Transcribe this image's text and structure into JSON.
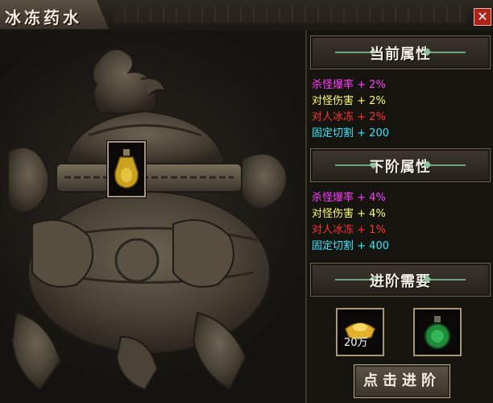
{
  "window": {
    "title": "冰冻药水",
    "close_label": "✕"
  },
  "colors": {
    "pink": "#ff3dff",
    "yellow": "#ffff66",
    "red": "#ff3131",
    "cyan": "#33e6ff"
  },
  "current_attrs": {
    "header": "当前属性",
    "rows": [
      {
        "name": "杀怪爆率",
        "value": "+ 2%",
        "color": "pink"
      },
      {
        "name": "对怪伤害",
        "value": "+ 2%",
        "color": "yellow"
      },
      {
        "name": "对人冰冻",
        "value": "+ 2%",
        "color": "red"
      },
      {
        "name": "固定切割",
        "value": "+ 200",
        "color": "cyan"
      }
    ]
  },
  "next_attrs": {
    "header": "下阶属性",
    "rows": [
      {
        "name": "杀怪爆率",
        "value": "+ 4%",
        "color": "pink"
      },
      {
        "name": "对怪伤害",
        "value": "+ 4%",
        "color": "yellow"
      },
      {
        "name": "对人冰冻",
        "value": "+ 1%",
        "color": "red"
      },
      {
        "name": "固定切割",
        "value": "+ 400",
        "color": "cyan"
      }
    ]
  },
  "requirements": {
    "header": "进阶需要",
    "gold_amount": "20万",
    "gold_icon": "gold-ingot-icon",
    "potion_icon": "green-potion-icon"
  },
  "advance_button": "点击进阶"
}
